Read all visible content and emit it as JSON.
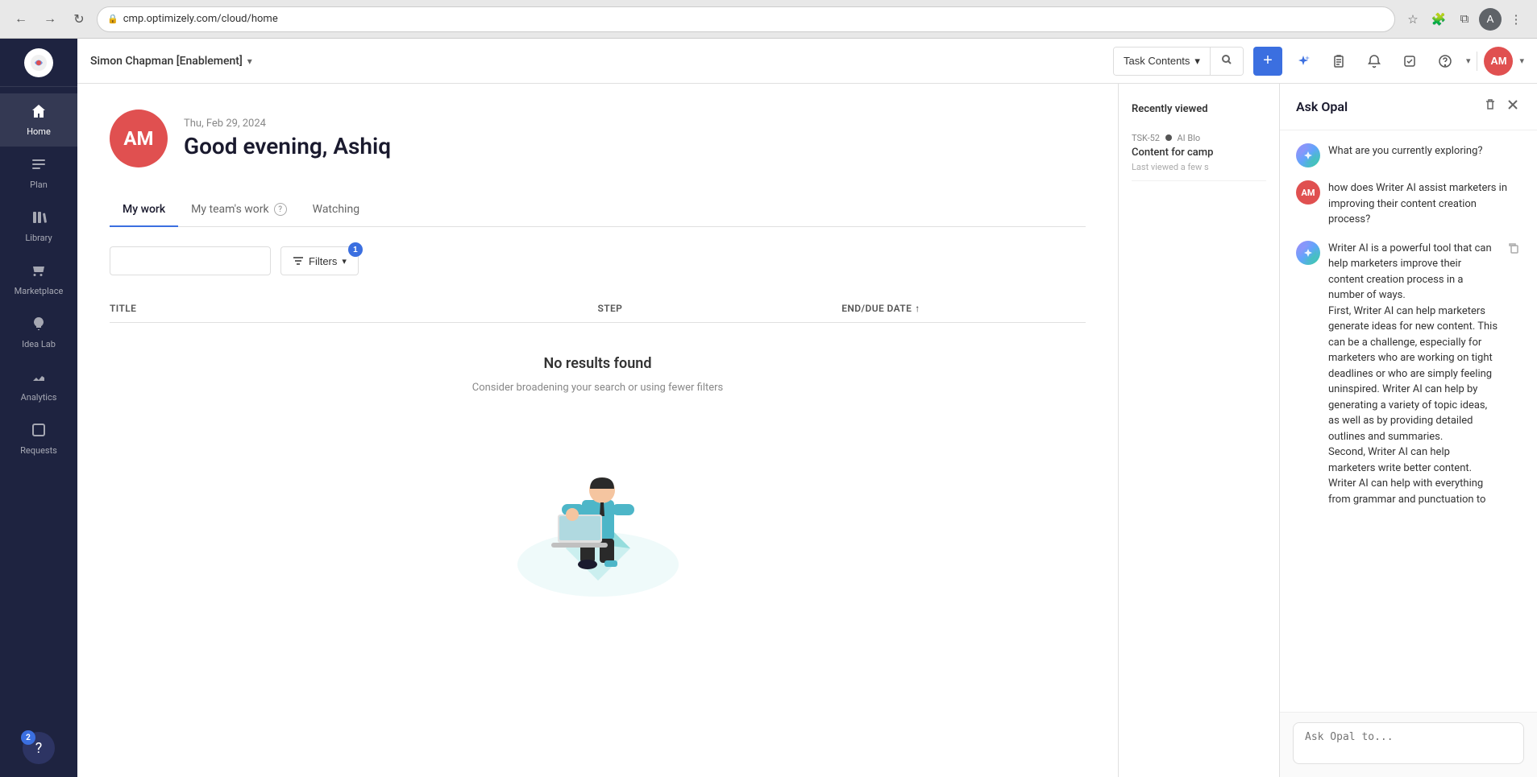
{
  "browser": {
    "url": "cmp.optimizely.com/cloud/home",
    "back_btn": "←",
    "forward_btn": "→",
    "refresh_btn": "↻"
  },
  "topbar": {
    "workspace": "Simon Chapman [Enablement]",
    "search_type": "Task Contents",
    "add_label": "+",
    "avatar_initials": "AM"
  },
  "sidebar": {
    "logo_emoji": "✦",
    "items": [
      {
        "id": "home",
        "label": "Home",
        "icon": "⌂",
        "active": true
      },
      {
        "id": "plan",
        "label": "Plan",
        "icon": "☰"
      },
      {
        "id": "library",
        "label": "Library",
        "icon": "⫿"
      },
      {
        "id": "marketplace",
        "label": "Marketplace",
        "icon": "◈"
      },
      {
        "id": "idea-lab",
        "label": "Idea Lab",
        "icon": "💡"
      },
      {
        "id": "analytics",
        "label": "Analytics",
        "icon": "⤴"
      },
      {
        "id": "requests",
        "label": "Requests",
        "icon": "⊡"
      }
    ],
    "help_badge_count": "2"
  },
  "user": {
    "initials": "AM",
    "date": "Thu, Feb 29, 2024",
    "greeting": "Good evening, Ashiq"
  },
  "tabs": [
    {
      "id": "my-work",
      "label": "My work",
      "active": true
    },
    {
      "id": "my-teams-work",
      "label": "My team's work",
      "has_help": true
    },
    {
      "id": "watching",
      "label": "Watching"
    }
  ],
  "work_area": {
    "search_placeholder": "",
    "filters_label": "Filters",
    "filter_count": "1",
    "columns": {
      "title": "Title",
      "step": "Step",
      "date": "End/Due Date"
    },
    "empty_title": "No results found",
    "empty_subtitle": "Consider broadening your search or using fewer filters"
  },
  "recently_viewed": {
    "title": "Recently viewed",
    "items": [
      {
        "id": "TSK-52",
        "category": "AI Blo",
        "title": "Content for camp",
        "time": "Last viewed a few s"
      }
    ]
  },
  "ask_opal": {
    "title": "Ask Opal",
    "messages": [
      {
        "type": "ai",
        "content": "What are you currently exploring?"
      },
      {
        "type": "user",
        "initials": "AM",
        "content": "how does Writer AI assist marketers in improving their content creation process?"
      },
      {
        "type": "ai",
        "content": "Writer AI is a powerful tool that can help marketers improve their content creation process in a number of ways.\nFirst, Writer AI can help marketers generate ideas for new content. This can be a challenge, especially for marketers who are working on tight deadlines or who are simply feeling uninspired. Writer AI can help by generating a variety of topic ideas, as well as by providing detailed outlines and summaries.\nSecond, Writer AI can help marketers write better content. Writer AI can help with everything from grammar and punctuation to"
      }
    ],
    "input_placeholder": "Ask Opal to..."
  }
}
